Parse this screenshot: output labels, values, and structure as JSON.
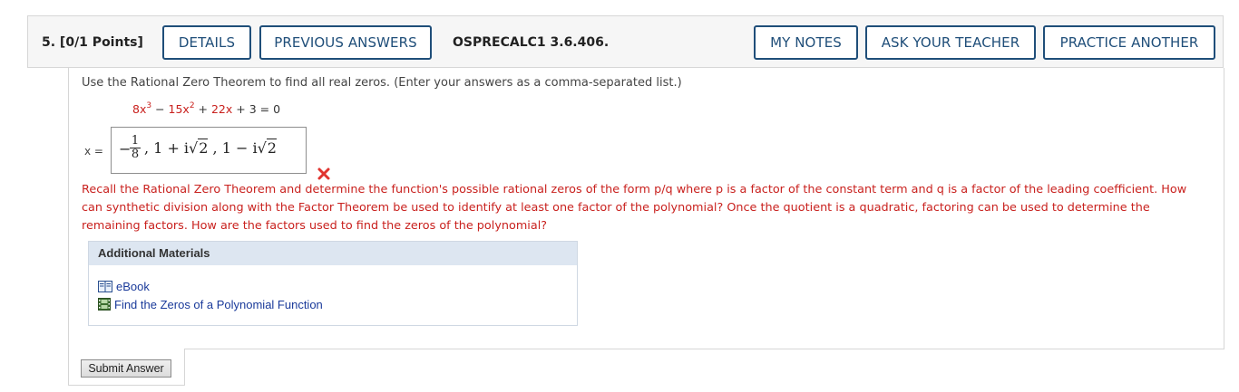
{
  "header": {
    "question_label": "5.  [0/1 Points]",
    "details_label": "DETAILS",
    "previous_answers_label": "PREVIOUS ANSWERS",
    "question_code": "OSPRECALC1 3.6.406.",
    "my_notes_label": "MY NOTES",
    "ask_teacher_label": "ASK YOUR TEACHER",
    "practice_another_label": "PRACTICE ANOTHER"
  },
  "question": {
    "instruction": "Use the Rational Zero Theorem to find all real zeros. (Enter your answers as a comma-separated list.)",
    "equation": {
      "t1_coef": "8",
      "t1_var": "x",
      "t1_exp": "3",
      "op1": " − ",
      "t2_coef": "15",
      "t2_var": "x",
      "t2_exp": "2",
      "op2": " + ",
      "t3_coef": "22",
      "t3_var": "x",
      "rest": " + 3 = 0"
    },
    "answer_label": "x =",
    "answer": {
      "minus": "−",
      "frac_num": "1",
      "frac_den": "8",
      "part1": ", 1 + i",
      "sqrt1": "2",
      "part2": " , 1 − i",
      "sqrt2": "2"
    },
    "status": "incorrect",
    "feedback": "Recall the Rational Zero Theorem and determine the function's possible rational zeros of the form  p/q  where p is a factor of the constant term and q is a factor of the leading coefficient. How can synthetic division along with the Factor Theorem be used to identify at least one factor of the polynomial? Once the quotient is a quadratic, factoring can be used to determine the remaining factors. How are the factors used to find the zeros of the polynomial?"
  },
  "additional_materials": {
    "title": "Additional Materials",
    "items": [
      {
        "label": "eBook",
        "icon": "book-icon"
      },
      {
        "label": "Find the Zeros of a Polynomial Function",
        "icon": "film-icon"
      }
    ]
  },
  "submit_label": "Submit Answer",
  "colors": {
    "accent": "#1f4e79",
    "error": "#c9211e",
    "link": "#1a3a9a"
  }
}
